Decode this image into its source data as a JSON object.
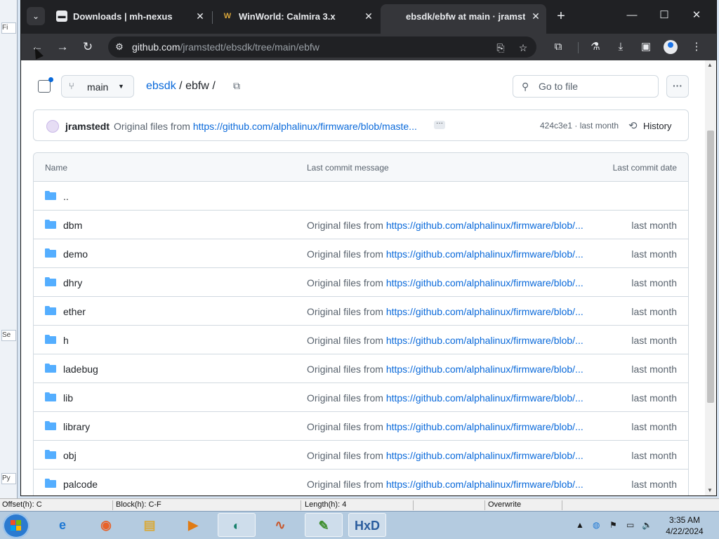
{
  "browser": {
    "tabs": [
      {
        "title": "Downloads | mh-nexus",
        "favicon": "monitor-icon",
        "active": false
      },
      {
        "title": "WinWorld: Calmira 3.x",
        "favicon": "winworld-icon",
        "active": false
      },
      {
        "title": "ebsdk/ebfw at main · jramstedt",
        "favicon": "github-icon",
        "active": true
      }
    ],
    "url_host": "github.com",
    "url_path": "/jramstedt/ebsdk/tree/main/ebfw"
  },
  "repo": {
    "branch": "main",
    "breadcrumb_repo": "ebsdk",
    "breadcrumb_sep": "/",
    "breadcrumb_dir": "ebfw",
    "breadcrumb_tail": "/",
    "search_placeholder": "Go to file",
    "more_label": "···"
  },
  "commit": {
    "author": "jramstedt",
    "message_prefix": "Original files from",
    "message_link": "https://github.com/alphalinux/firmware/blob/maste...",
    "ellipsis": "···",
    "meta": "424c3e1 · last month",
    "history_label": "History"
  },
  "table": {
    "headers": {
      "name": "Name",
      "message": "Last commit message",
      "date": "Last commit date"
    },
    "rows": [
      {
        "name": "..",
        "prefix": "",
        "link": "",
        "date": ""
      },
      {
        "name": "dbm",
        "prefix": "Original files from",
        "link": "https://github.com/alphalinux/firmware/blob/...",
        "date": "last month"
      },
      {
        "name": "demo",
        "prefix": "Original files from",
        "link": "https://github.com/alphalinux/firmware/blob/...",
        "date": "last month"
      },
      {
        "name": "dhry",
        "prefix": "Original files from",
        "link": "https://github.com/alphalinux/firmware/blob/...",
        "date": "last month"
      },
      {
        "name": "ether",
        "prefix": "Original files from",
        "link": "https://github.com/alphalinux/firmware/blob/...",
        "date": "last month"
      },
      {
        "name": "h",
        "prefix": "Original files from",
        "link": "https://github.com/alphalinux/firmware/blob/...",
        "date": "last month"
      },
      {
        "name": "ladebug",
        "prefix": "Original files from",
        "link": "https://github.com/alphalinux/firmware/blob/...",
        "date": "last month"
      },
      {
        "name": "lib",
        "prefix": "Original files from",
        "link": "https://github.com/alphalinux/firmware/blob/...",
        "date": "last month"
      },
      {
        "name": "library",
        "prefix": "Original files from",
        "link": "https://github.com/alphalinux/firmware/blob/...",
        "date": "last month"
      },
      {
        "name": "obj",
        "prefix": "Original files from",
        "link": "https://github.com/alphalinux/firmware/blob/...",
        "date": "last month"
      },
      {
        "name": "palcode",
        "prefix": "Original files from",
        "link": "https://github.com/alphalinux/firmware/blob/...",
        "date": "last month"
      }
    ]
  },
  "hex_status": {
    "offset": "Offset(h): C",
    "block": "Block(h): C-F",
    "length": "Length(h): 4",
    "mode": "Overwrite"
  },
  "background_app": {
    "cells": [
      "Fi",
      "Se",
      "Py"
    ]
  },
  "taskbar": {
    "time": "3:35 AM",
    "date": "4/22/2024",
    "apps": [
      "ie-icon",
      "firefox-icon",
      "explorer-icon",
      "media-player-icon",
      "chrome-canary-icon",
      "matlab-icon",
      "notepadpp-icon",
      "hxd-icon"
    ]
  },
  "colors": {
    "accent": "#0969da",
    "folder": "#54aeff",
    "chrome_dark": "#202124",
    "chrome_toolbar": "#35363a"
  }
}
